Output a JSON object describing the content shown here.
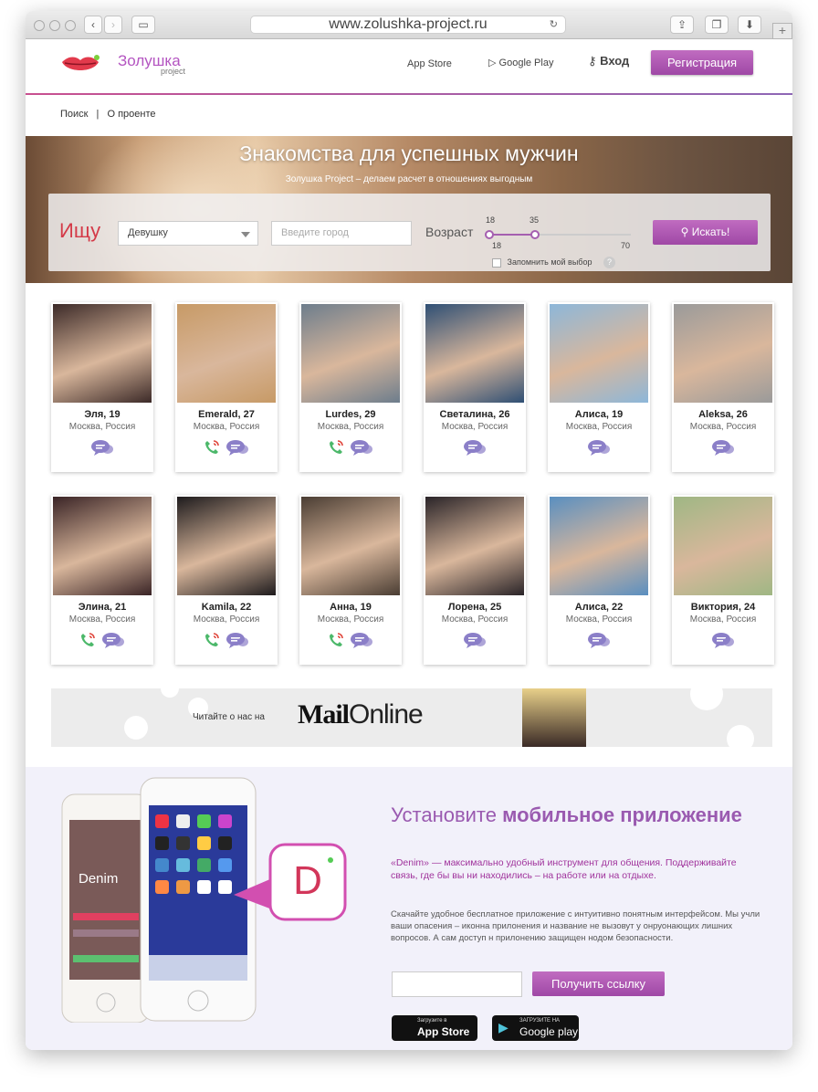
{
  "browser": {
    "url": "www.zolushka-project.ru"
  },
  "header": {
    "logo_text": "Золушка",
    "logo_sub": "project",
    "app_store": "App Store",
    "google_play": "Google Play",
    "login": "Вход",
    "register": "Регистрация"
  },
  "breadcrumbs": {
    "search": "Поиск",
    "separator": "|",
    "about": "О проенте"
  },
  "hero": {
    "title": "Знакомства для успешных мужчин",
    "subtitle": "Золушка Project – делаем расчет в отношениях выгодным"
  },
  "search": {
    "label": "Ищу",
    "gender_value": "Девушку",
    "city_placeholder": "Введите город",
    "age_label": "Возраст",
    "age_min_selected": "18",
    "age_max_selected": "35",
    "age_min": "18",
    "age_max": "70",
    "button": "Искать!",
    "remember": "Запомнить мой выбор",
    "help": "?"
  },
  "colors": {
    "accent": "#a94fb0",
    "red": "#d43a48",
    "chat": "#8b7fc8",
    "call": "#e0463c"
  },
  "profiles": [
    {
      "name": "Эля, 19",
      "location": "Москва, Россия",
      "call": false,
      "photo": "#3c2a28"
    },
    {
      "name": "Emerald, 27",
      "location": "Москва, Россия",
      "call": true,
      "photo": "#c79a66"
    },
    {
      "name": "Lurdes, 29",
      "location": "Москва, Россия",
      "call": true,
      "photo": "#6d7d8c"
    },
    {
      "name": "Светалина, 26",
      "location": "Москва, Россия",
      "call": false,
      "photo": "#2f4f74"
    },
    {
      "name": "Алиса, 19",
      "location": "Москва, Россия",
      "call": false,
      "photo": "#8db7d9"
    },
    {
      "name": "Aleksa, 26",
      "location": "Москва, Россия",
      "call": false,
      "photo": "#9a9a9a"
    },
    {
      "name": "Элина, 21",
      "location": "Москва, Россия",
      "call": true,
      "photo": "#3a2426"
    },
    {
      "name": "Kamila, 22",
      "location": "Москва, Россия",
      "call": true,
      "photo": "#1e1b1d"
    },
    {
      "name": "Анна, 19",
      "location": "Москва, Россия",
      "call": true,
      "photo": "#4a3d33"
    },
    {
      "name": "Лорена, 25",
      "location": "Москва, Россия",
      "call": false,
      "photo": "#2a2428"
    },
    {
      "name": "Алиса, 22",
      "location": "Москва, Россия",
      "call": false,
      "photo": "#5a8fc0"
    },
    {
      "name": "Виктория, 24",
      "location": "Москва, Россия",
      "call": false,
      "photo": "#9fb784"
    }
  ],
  "press": {
    "text": "Читайте о нас на",
    "logo_bold": "Mail",
    "logo_light": "Online"
  },
  "app": {
    "title_light": "Установите ",
    "title_bold": "мобильное приложение",
    "desc1": "«Denim» — максимально удобный инструмент для общения. Поддерживайте связь, где бы вы ни находились – на работе или на отдыхе.",
    "desc2": "Скачайте удобное бесплатное приложение с интуитивно понятным интерфейсом. Мы учли ваши опасения – иконна прилонения и название не вызовут у онруонающих лишних вопросов. А сам доступ н прилонению защищен нодом безопасности.",
    "button": "Получить ссылку",
    "appstore_small": "Загрузите в",
    "appstore_big": "App Store",
    "gplay_small": "ЗАГРУЗИТЕ НА",
    "gplay_big": "Google play",
    "phone_brand": "Denim",
    "phone_icon_letter": "D"
  }
}
